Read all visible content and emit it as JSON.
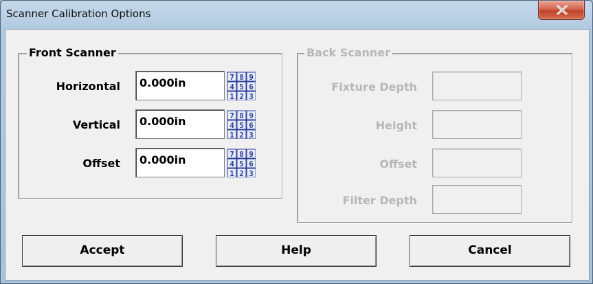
{
  "window": {
    "title": "Scanner Calibration Options",
    "close_glyph": "x"
  },
  "front_scanner": {
    "label": "Front Scanner",
    "fields": [
      {
        "label": "Horizontal",
        "value": "0.000in"
      },
      {
        "label": "Vertical",
        "value": "0.000in"
      },
      {
        "label": "Offset",
        "value": "0.000in"
      }
    ],
    "keypad_digits": [
      "7",
      "8",
      "9",
      "4",
      "5",
      "6",
      "1",
      "2",
      "3"
    ]
  },
  "back_scanner": {
    "label": "Back Scanner",
    "fields": [
      {
        "label": "Fixture Depth",
        "value": ""
      },
      {
        "label": "Height",
        "value": ""
      },
      {
        "label": "Offset",
        "value": ""
      },
      {
        "label": "Filter Depth",
        "value": ""
      }
    ]
  },
  "buttons": {
    "accept": "Accept",
    "help": "Help",
    "cancel": "Cancel"
  },
  "colors": {
    "keypad_fill": "#2f3f9e",
    "disabled_text": "#b7b7b7",
    "close_red": "#c8452d"
  }
}
